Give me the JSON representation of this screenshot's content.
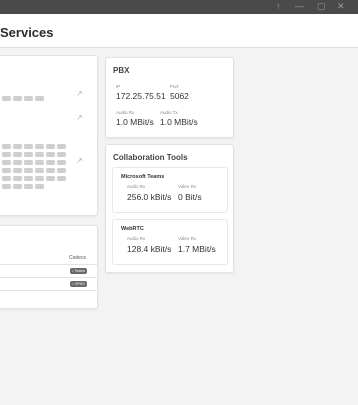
{
  "window": {
    "controls": [
      "↑",
      "—",
      "▢",
      "✕"
    ]
  },
  "header": {
    "title": "Services"
  },
  "pbx": {
    "heading": "PBX",
    "ip_label": "IP",
    "ip_value": "172.25.75.51",
    "port_label": "Port",
    "port_value": "5062",
    "audio_rx_label": "Audio Rx",
    "audio_rx_value": "1.0 MBit/s",
    "audio_tx_label": "Audio Tx",
    "audio_tx_value": "1.0 MBit/s"
  },
  "collaboration": {
    "heading": "Collaboration Tools",
    "teams": {
      "title": "Microsoft Teams",
      "audio_rx_label": "Audio Rx",
      "audio_rx_value": "256.0 kBit/s",
      "video_rx_label": "Video Rx",
      "video_rx_value": "0 Bit/s"
    },
    "webrtc": {
      "title": "WebRTC",
      "audio_rx_label": "Audio Rx",
      "audio_rx_value": "128.4 kBit/s",
      "video_rx_label": "Video Rx",
      "video_rx_value": "1.7 MBit/s"
    }
  },
  "codecs": {
    "header": "Codecs",
    "rows": [
      {
        "tag": "♪ Teams"
      },
      {
        "tag": "♪ OPUS"
      }
    ]
  },
  "icons": {
    "external_link": "↗"
  }
}
